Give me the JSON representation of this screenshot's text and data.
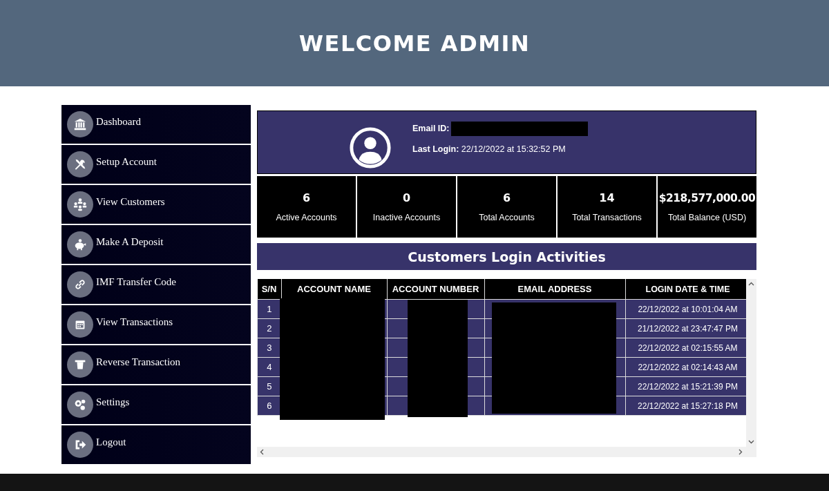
{
  "header": {
    "title": "WELCOME ADMIN"
  },
  "sidebar": {
    "items": [
      {
        "label": "Dashboard"
      },
      {
        "label": "Setup Account"
      },
      {
        "label": "View Customers"
      },
      {
        "label": "Make A Deposit"
      },
      {
        "label": "IMF Transfer Code"
      },
      {
        "label": "View Transactions"
      },
      {
        "label": "Reverse Transaction"
      },
      {
        "label": "Settings"
      },
      {
        "label": "Logout"
      }
    ]
  },
  "profile": {
    "email_label": "Email ID:",
    "last_login_label": "Last Login:",
    "last_login": "22/12/2022 at 15:32:52 PM"
  },
  "stats": [
    {
      "value": "6",
      "label": "Active Accounts"
    },
    {
      "value": "0",
      "label": "Inactive Accounts"
    },
    {
      "value": "6",
      "label": "Total Accounts"
    },
    {
      "value": "14",
      "label": "Total Transactions"
    },
    {
      "value": "$218,577,000.00",
      "label": "Total Balance (USD)"
    }
  ],
  "activities": {
    "title": "Customers Login Activities",
    "columns": [
      "S/N",
      "ACCOUNT NAME",
      "ACCOUNT NUMBER",
      "EMAIL ADDRESS",
      "LOGIN DATE & TIME"
    ],
    "rows": [
      {
        "sn": "1",
        "login": "22/12/2022 at 10:01:04 AM"
      },
      {
        "sn": "2",
        "login": "21/12/2022 at 23:47:47 PM"
      },
      {
        "sn": "3",
        "login": "22/12/2022 at 02:15:55 AM"
      },
      {
        "sn": "4",
        "login": "22/12/2022 at 02:14:43 AM"
      },
      {
        "sn": "5",
        "login": "22/12/2022 at 15:21:39 PM"
      },
      {
        "sn": "6",
        "login": "22/12/2022 at 15:27:18 PM"
      }
    ]
  }
}
